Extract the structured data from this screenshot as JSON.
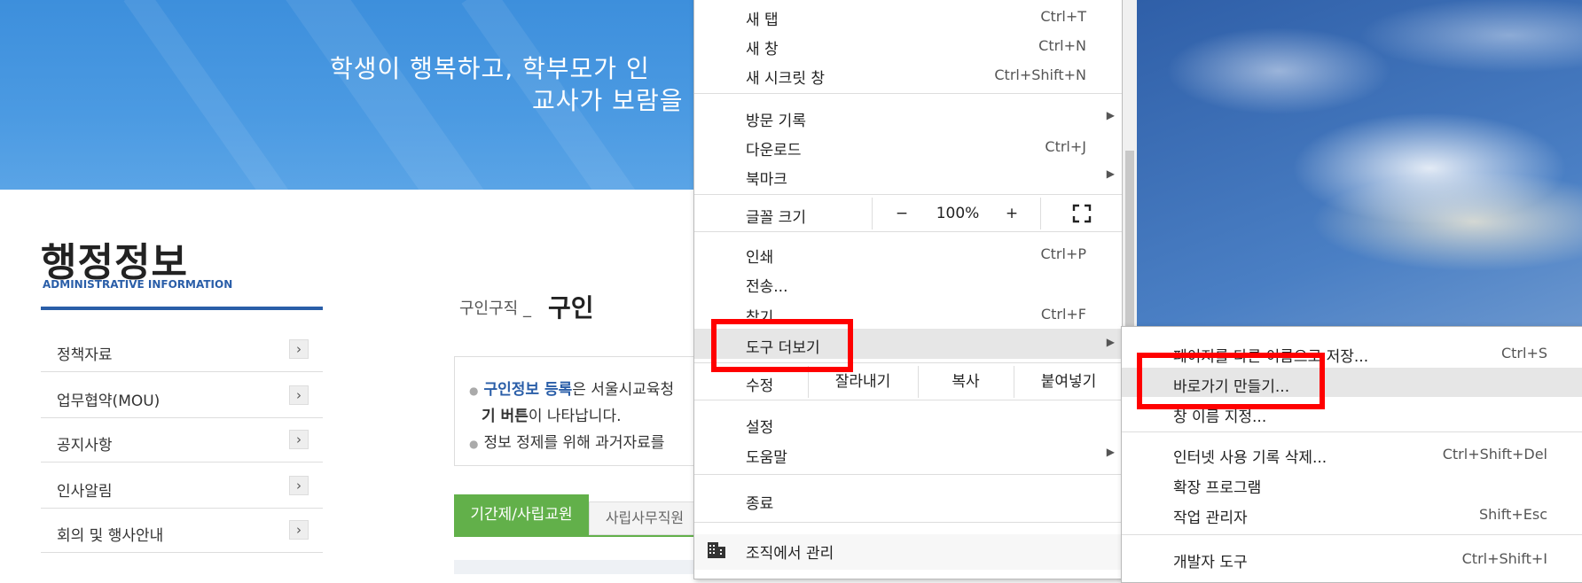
{
  "website": {
    "banner": {
      "line1": "학생이 행복하고, 학부모가 인",
      "line2": "교사가 보람을"
    },
    "section": {
      "title": "행정정보",
      "subtitle": "ADMINISTRATIVE INFORMATION"
    },
    "sidebar": {
      "items": [
        {
          "label": "정책자료"
        },
        {
          "label": "업무협약(MOU)"
        },
        {
          "label": "공지사항"
        },
        {
          "label": "인사알림"
        },
        {
          "label": "회의 및 행사안내"
        }
      ],
      "arrow_glyph": "›"
    },
    "breadcrumb": "구인구직 _",
    "page_title": "구인",
    "info": {
      "line1_link": "구인정보 등록",
      "line1_rest": "은 서울시교육청",
      "line2_bold": "기 버튼",
      "line2_rest": "이 나타납니다.",
      "line3": "정보 정제를 위해 과거자료를"
    },
    "tabs": {
      "active": "기간제/사립교원",
      "inactive": "사립사무직원"
    }
  },
  "menu": {
    "items_top": [
      {
        "label": "새 탭",
        "shortcut": "Ctrl+T"
      },
      {
        "label": "새 창",
        "shortcut": "Ctrl+N"
      },
      {
        "label": "새 시크릿 창",
        "shortcut": "Ctrl+Shift+N"
      }
    ],
    "items_history": [
      {
        "label": "방문 기록",
        "shortcut": "",
        "submenu": true
      },
      {
        "label": "다운로드",
        "shortcut": "Ctrl+J"
      },
      {
        "label": "북마크",
        "shortcut": "",
        "submenu": true
      }
    ],
    "zoom": {
      "label": "글꼴 크기",
      "minus": "−",
      "value": "100%",
      "plus": "+",
      "fullscreen_icon": "fullscreen-icon"
    },
    "items_print": [
      {
        "label": "인쇄",
        "shortcut": "Ctrl+P"
      },
      {
        "label": "전송...",
        "shortcut": ""
      },
      {
        "label": "찾기",
        "shortcut": "Ctrl+F"
      },
      {
        "label": "도구 더보기",
        "shortcut": "",
        "submenu": true
      }
    ],
    "edit": {
      "label": "수정",
      "cut": "잘라내기",
      "copy": "복사",
      "paste": "붙여넣기"
    },
    "items_settings": [
      {
        "label": "설정",
        "shortcut": ""
      },
      {
        "label": "도움말",
        "shortcut": "",
        "submenu": true
      }
    ],
    "exit": "종료",
    "managed": "조직에서 관리",
    "submenu_arrow": "▶"
  },
  "submenu": {
    "items": [
      {
        "label": "페이지를 다른 이름으로 저장...",
        "shortcut": "Ctrl+S"
      },
      {
        "label": "바로가기 만들기...",
        "shortcut": ""
      },
      {
        "label": "창 이름 지정...",
        "shortcut": ""
      },
      {
        "label": "인터넷 사용 기록 삭제...",
        "shortcut": "Ctrl+Shift+Del"
      },
      {
        "label": "확장 프로그램",
        "shortcut": ""
      },
      {
        "label": "작업 관리자",
        "shortcut": "Shift+Esc"
      },
      {
        "label": "개발자 도구",
        "shortcut": "Ctrl+Shift+I"
      }
    ]
  },
  "colors": {
    "highlight_box": "#ff0000",
    "banner_blue": "#4b9ae2",
    "accent_green": "#62b04a",
    "admin_blue": "#2a5ea8"
  }
}
